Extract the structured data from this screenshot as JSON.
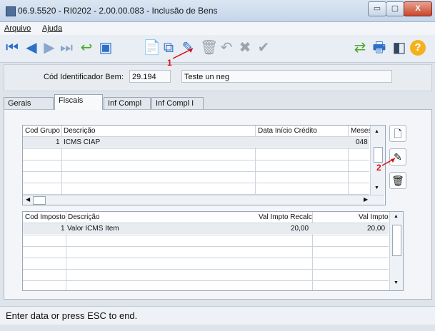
{
  "window": {
    "title": "06.9.5520 - RI0202 - 2.00.00.083 - Inclusão de Bens",
    "min_label": "▭",
    "max_label": "▢",
    "close_label": "X"
  },
  "menu": {
    "items": [
      "Arquivo",
      "Ajuda"
    ]
  },
  "toolbar": {
    "icons": [
      {
        "name": "first",
        "glyph": "⏮",
        "color": "#2e6fc7"
      },
      {
        "name": "prev",
        "glyph": "◀",
        "color": "#2e6fc7"
      },
      {
        "name": "next",
        "glyph": "▶",
        "color": "#8aa6cc"
      },
      {
        "name": "last",
        "glyph": "⏭",
        "color": "#8aa6cc"
      },
      {
        "name": "back",
        "glyph": "↩",
        "color": "#4caa2b"
      },
      {
        "name": "view",
        "glyph": "▣",
        "color": "#2e6fc7"
      },
      {
        "name": "new",
        "glyph": "📄",
        "color": "#2e6fc7"
      },
      {
        "name": "copy",
        "glyph": "⧉",
        "color": "#2e6fc7"
      },
      {
        "name": "edit",
        "glyph": "✎",
        "color": "#2e6fc7"
      },
      {
        "name": "delete",
        "glyph": "🗑",
        "color": "#9aa4ad"
      },
      {
        "name": "undo",
        "glyph": "↶",
        "color": "#9aa4ad"
      },
      {
        "name": "cancel",
        "glyph": "✖",
        "color": "#9aa4ad"
      },
      {
        "name": "confirm",
        "glyph": "✔",
        "color": "#9aa4ad"
      }
    ],
    "right_icons": [
      {
        "name": "navigate",
        "glyph": "⇄",
        "color": "#4caa2b"
      },
      {
        "name": "print",
        "glyph": "🖶",
        "color": "#2e6fc7"
      },
      {
        "name": "exit",
        "glyph": "◧",
        "color": "#34475e"
      },
      {
        "name": "help",
        "glyph": "?",
        "color": "#e39b16"
      }
    ]
  },
  "header": {
    "label": "Cód Identificador Bem:",
    "code": "29.194",
    "description": "Teste un neg"
  },
  "tabs": [
    "Gerais",
    "Fiscais",
    "Inf Compl",
    "Inf Compl I"
  ],
  "active_tab": "Fiscais",
  "grid1": {
    "columns": [
      "Cod Grupo",
      "Descrição",
      "Data Início Crédito",
      "Meses"
    ],
    "rows": [
      {
        "cod": "1",
        "desc": "ICMS CIAP",
        "data": "",
        "meses": "048"
      }
    ]
  },
  "grid2": {
    "columns": [
      "Cod Imposto",
      "Descrição",
      "Val Impto Recalc",
      "Val Impto"
    ],
    "rows": [
      {
        "cod": "1",
        "desc": "Valor ICMS Item",
        "recalc": "20,00",
        "val": "20,00"
      }
    ]
  },
  "callouts": {
    "one": "1",
    "two": "2"
  },
  "status": {
    "text": "Enter data or press ESC to end."
  }
}
